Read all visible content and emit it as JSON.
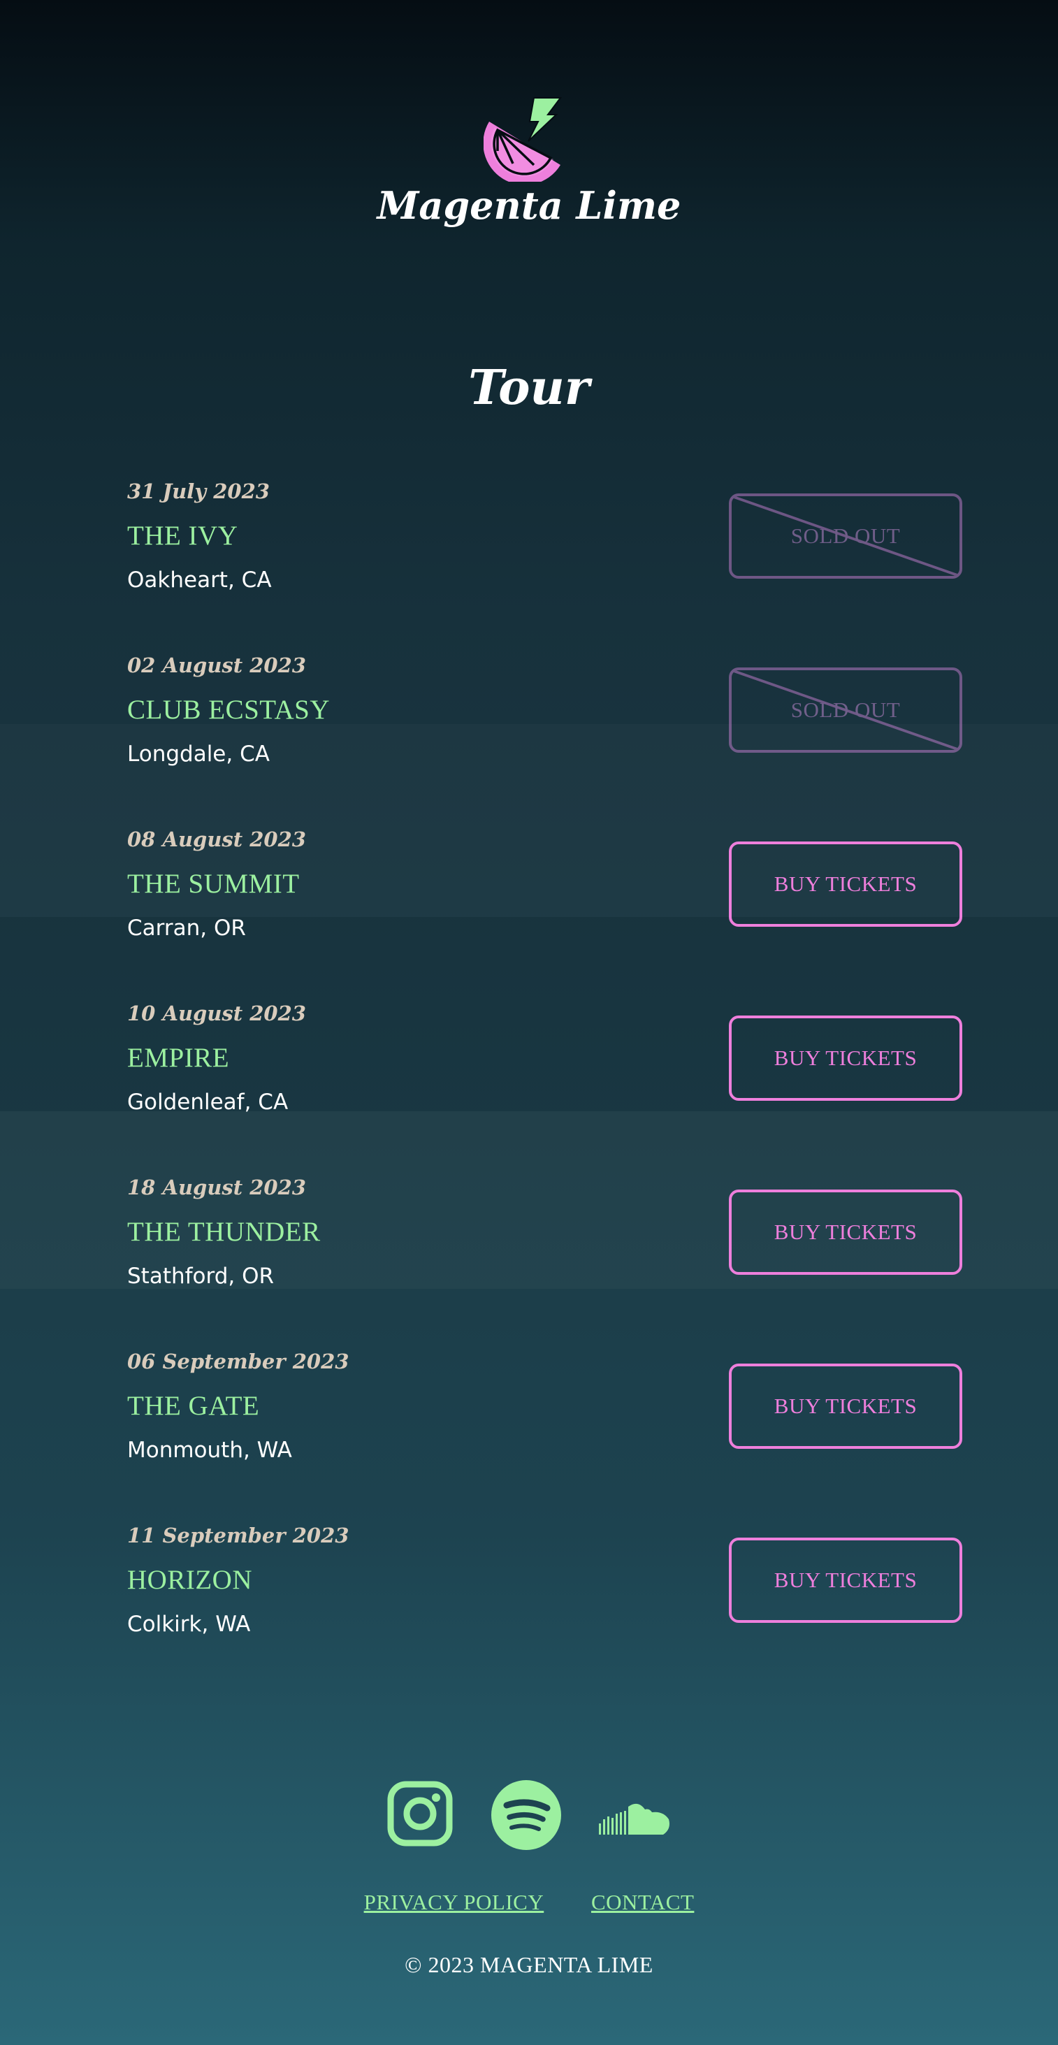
{
  "brand": {
    "name": "Magenta Lime",
    "logo_icon": "lime-slice-lightning-icon"
  },
  "page": {
    "title": "Tour"
  },
  "colors": {
    "accent_green": "#9cf0a0",
    "accent_magenta": "#ee7fdc",
    "date_text": "#d9ccbc"
  },
  "tour": [
    {
      "date": "31 July 2023",
      "venue": "THE IVY",
      "city": "Oakheart, CA",
      "button": "SOLD OUT",
      "sold_out": true
    },
    {
      "date": "02 August 2023",
      "venue": "CLUB ECSTASY",
      "city": "Longdale, CA",
      "button": "SOLD OUT",
      "sold_out": true
    },
    {
      "date": "08 August 2023",
      "venue": "THE SUMMIT",
      "city": "Carran, OR",
      "button": "BUY TICKETS",
      "sold_out": false
    },
    {
      "date": "10 August 2023",
      "venue": "EMPIRE",
      "city": "Goldenleaf, CA",
      "button": "BUY TICKETS",
      "sold_out": false
    },
    {
      "date": "18 August 2023",
      "venue": "THE THUNDER",
      "city": "Stathford, OR",
      "button": "BUY TICKETS",
      "sold_out": false
    },
    {
      "date": "06 September 2023",
      "venue": "THE GATE",
      "city": "Monmouth, WA",
      "button": "BUY TICKETS",
      "sold_out": false
    },
    {
      "date": "11 September 2023",
      "venue": "HORIZON",
      "city": "Colkirk, WA",
      "button": "BUY TICKETS",
      "sold_out": false
    }
  ],
  "footer": {
    "social": [
      {
        "name": "instagram-icon"
      },
      {
        "name": "spotify-icon"
      },
      {
        "name": "soundcloud-icon"
      }
    ],
    "links": {
      "privacy": "PRIVACY POLICY",
      "contact": "CONTACT"
    },
    "copyright": "© 2023 MAGENTA LIME"
  }
}
